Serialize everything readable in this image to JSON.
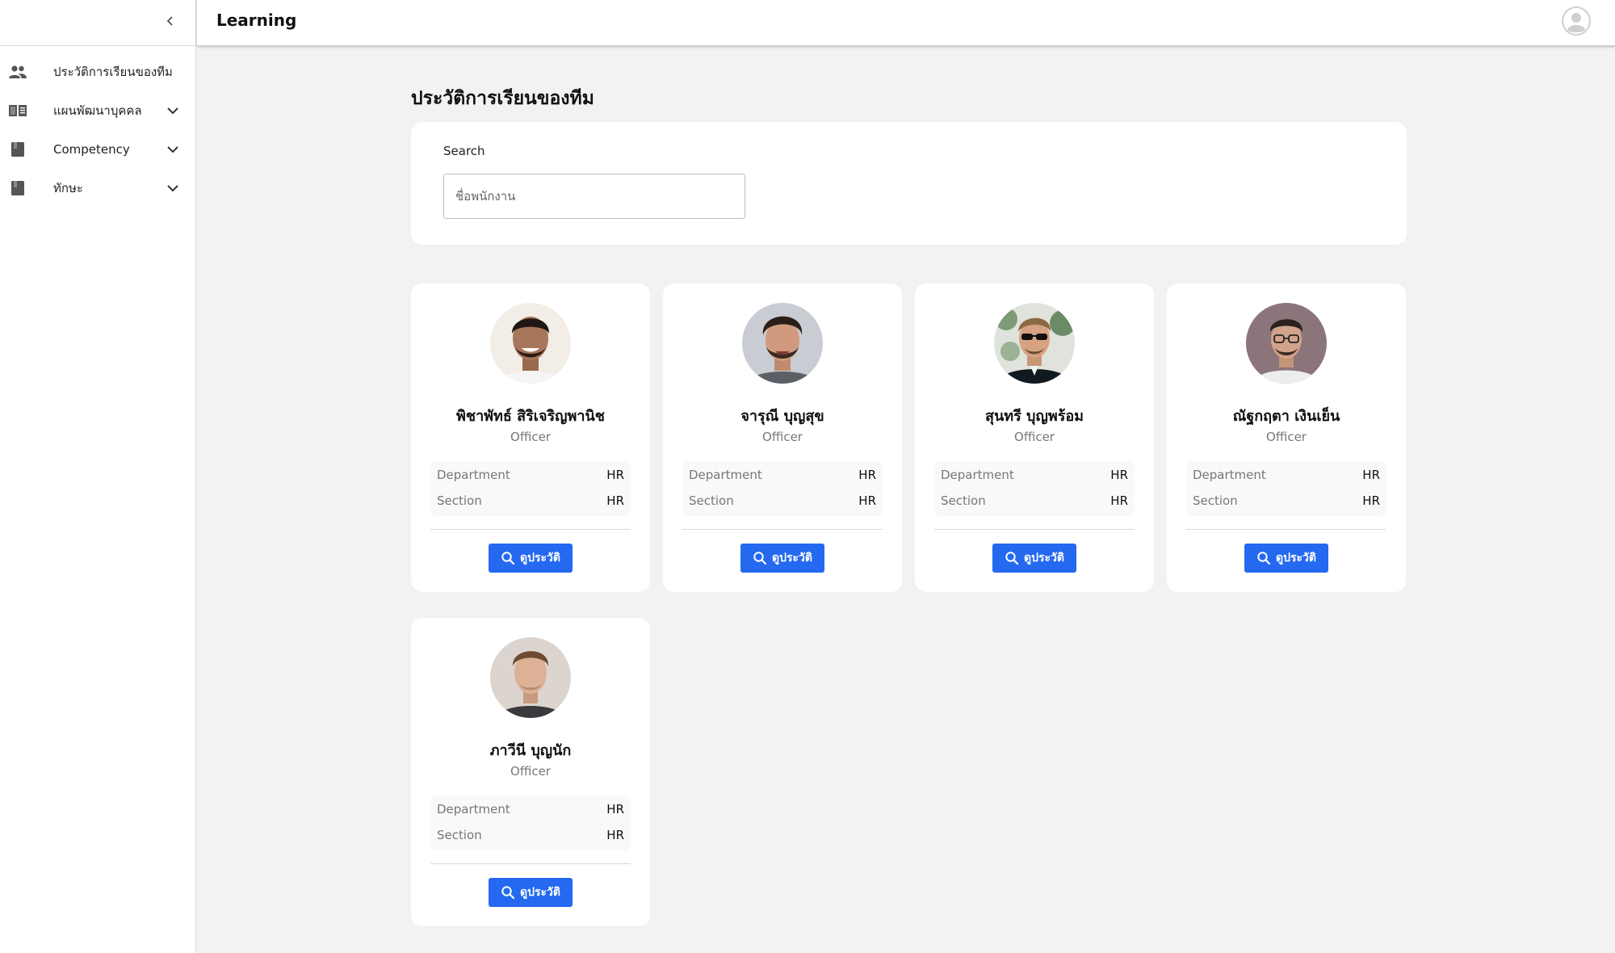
{
  "topbar": {
    "title": "Learning"
  },
  "sidebar": {
    "items": [
      {
        "label": "ประวัติการเรียนของทีม",
        "icon": "people-icon",
        "expandable": false
      },
      {
        "label": "แผนพัฒนาบุคคล",
        "icon": "book-open-icon",
        "expandable": true
      },
      {
        "label": "Competency",
        "icon": "book-icon",
        "expandable": true
      },
      {
        "label": "ทักษะ",
        "icon": "book-icon",
        "expandable": true
      }
    ]
  },
  "page": {
    "title": "ประวัติการเรียนของทีม"
  },
  "search": {
    "label": "Search",
    "placeholder": "ชื่อพนักงาน",
    "value": ""
  },
  "employees": [
    {
      "name": "พิชาพัทธ์ สิริเจริญพานิช",
      "role": "Officer",
      "department_label": "Department",
      "department": "HR",
      "section_label": "Section",
      "section": "HR",
      "button_label": "ดูประวัติ"
    },
    {
      "name": "จารุณี บุญสุข",
      "role": "Officer",
      "department_label": "Department",
      "department": "HR",
      "section_label": "Section",
      "section": "HR",
      "button_label": "ดูประวัติ"
    },
    {
      "name": "สุนทรี บุญพร้อม",
      "role": "Officer",
      "department_label": "Department",
      "department": "HR",
      "section_label": "Section",
      "section": "HR",
      "button_label": "ดูประวัติ"
    },
    {
      "name": "ณัฐกฤตา เงินเย็น",
      "role": "Officer",
      "department_label": "Department",
      "department": "HR",
      "section_label": "Section",
      "section": "HR",
      "button_label": "ดูประวัติ"
    },
    {
      "name": "ภาวีนี บุญนัก",
      "role": "Officer",
      "department_label": "Department",
      "department": "HR",
      "section_label": "Section",
      "section": "HR",
      "button_label": "ดูประวัติ"
    }
  ],
  "colors": {
    "accent": "#2469f0",
    "background": "#f2f2f2",
    "card": "#ffffff",
    "muted": "#777777"
  }
}
